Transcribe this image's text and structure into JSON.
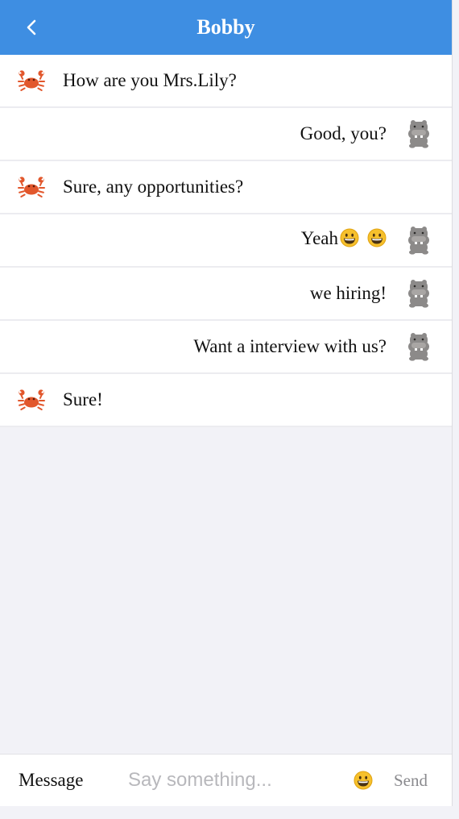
{
  "header": {
    "title": "Bobby",
    "back_icon": "chevron-left-icon"
  },
  "colors": {
    "header_bg": "#3e8ee2",
    "background": "#f2f2f7",
    "crab": "#e2572c",
    "hippo": "#8c8a89"
  },
  "messages": [
    {
      "side": "left",
      "avatar": "crab",
      "text": "How are you Mrs.Lily?"
    },
    {
      "side": "right",
      "avatar": "hippo",
      "text": "Good, you?"
    },
    {
      "side": "left",
      "avatar": "crab",
      "text": "Sure, any opportunities?"
    },
    {
      "side": "right",
      "avatar": "hippo",
      "text": "Yeah",
      "emojis": 2
    },
    {
      "side": "right",
      "avatar": "hippo",
      "text": "we hiring!"
    },
    {
      "side": "right",
      "avatar": "hippo",
      "text": "Want a interview with us?"
    },
    {
      "side": "left",
      "avatar": "crab",
      "text": "Sure!"
    }
  ],
  "composer": {
    "label": "Message",
    "placeholder": "Say something...",
    "value": "",
    "emoji_icon": "grinning-face-icon",
    "send_label": "Send"
  }
}
